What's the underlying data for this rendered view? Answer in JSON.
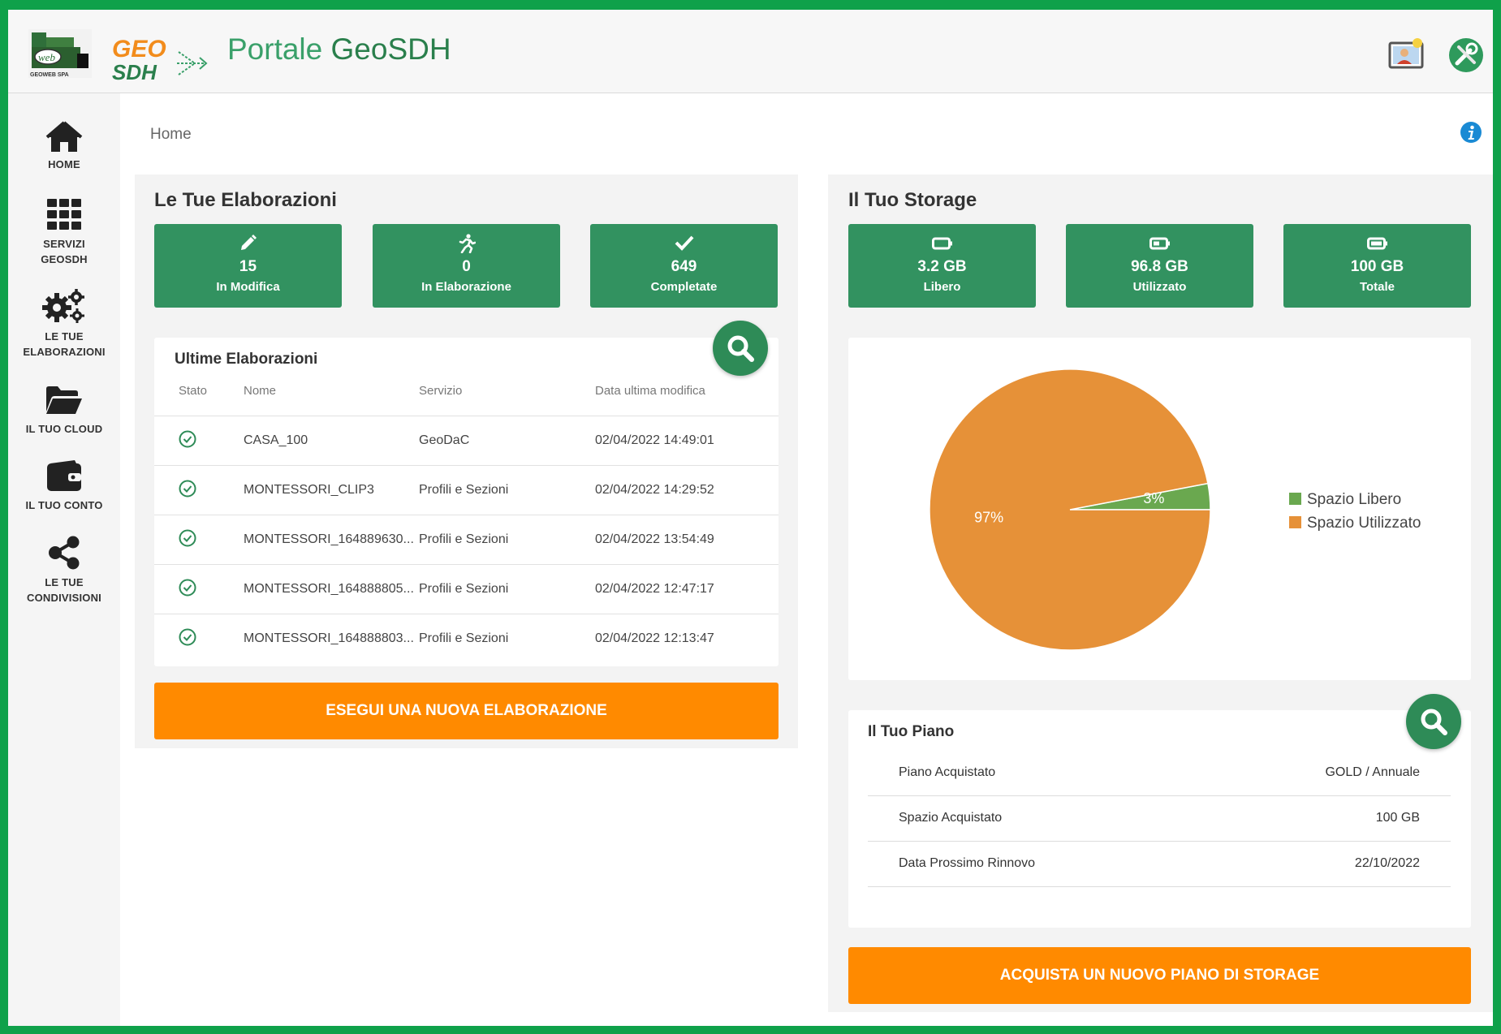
{
  "header": {
    "logo_geoweb_text": "GEOWEB SPA",
    "logo_geosdh_text": "GEO SDH",
    "title_light": "Portale ",
    "title_strong": "GeoSDH"
  },
  "sidebar": {
    "items": [
      {
        "label_line1": "HOME",
        "label_line2": "",
        "icon": "home-icon"
      },
      {
        "label_line1": "SERVIZI",
        "label_line2": "GEOSDH",
        "icon": "grid-icon"
      },
      {
        "label_line1": "LE TUE",
        "label_line2": "ELABORAZIONI",
        "icon": "gears-icon"
      },
      {
        "label_line1": "IL TUO CLOUD",
        "label_line2": "",
        "icon": "folder-open-icon"
      },
      {
        "label_line1": "IL TUO CONTO",
        "label_line2": "",
        "icon": "wallet-icon"
      },
      {
        "label_line1": "LE TUE",
        "label_line2": "CONDIVISIONI",
        "icon": "share-icon"
      }
    ]
  },
  "breadcrumb": "Home",
  "elaborazioni": {
    "title": "Le Tue Elaborazioni",
    "stats": [
      {
        "value": "15",
        "caption": "In Modifica",
        "icon": "pencil-icon"
      },
      {
        "value": "0",
        "caption": "In Elaborazione",
        "icon": "running-icon"
      },
      {
        "value": "649",
        "caption": "Completate",
        "icon": "check-icon"
      }
    ],
    "recent": {
      "title": "Ultime Elaborazioni",
      "columns": [
        "Stato",
        "Nome",
        "Servizio",
        "Data ultima modifica"
      ],
      "rows": [
        {
          "nome": "CASA_100",
          "servizio": "GeoDaC",
          "data": "02/04/2022 14:49:01"
        },
        {
          "nome": "MONTESSORI_CLIP3",
          "servizio": "Profili e Sezioni",
          "data": "02/04/2022 14:29:52"
        },
        {
          "nome": "MONTESSORI_164889630...",
          "servizio": "Profili e Sezioni",
          "data": "02/04/2022 13:54:49"
        },
        {
          "nome": "MONTESSORI_164888805...",
          "servizio": "Profili e Sezioni",
          "data": "02/04/2022 12:47:17"
        },
        {
          "nome": "MONTESSORI_164888803...",
          "servizio": "Profili e Sezioni",
          "data": "02/04/2022 12:13:47"
        }
      ]
    },
    "action_label": "ESEGUI UNA NUOVA ELABORAZIONE"
  },
  "storage": {
    "title": "Il Tuo Storage",
    "stats": [
      {
        "value": "3.2 GB",
        "caption": "Libero",
        "icon": "battery-empty-icon"
      },
      {
        "value": "96.8 GB",
        "caption": "Utilizzato",
        "icon": "battery-half-icon"
      },
      {
        "value": "100 GB",
        "caption": "Totale",
        "icon": "battery-full-icon"
      }
    ],
    "plan": {
      "title": "Il Tuo Piano",
      "rows": [
        {
          "key": "Piano Acquistato",
          "value": "GOLD / Annuale"
        },
        {
          "key": "Spazio Acquistato",
          "value": "100 GB"
        },
        {
          "key": "Data Prossimo Rinnovo",
          "value": "22/10/2022"
        }
      ]
    },
    "action_label": "ACQUISTA UN NUOVO PIANO DI STORAGE"
  },
  "chart_data": {
    "type": "pie",
    "categories": [
      "Spazio Libero",
      "Spazio Utilizzato"
    ],
    "values": [
      3,
      97
    ],
    "labels": [
      "3%",
      "97%"
    ],
    "colors": [
      "#6aa84f",
      "#e69138"
    ],
    "legend": "right"
  },
  "colors": {
    "brand_green": "#329260",
    "frame_green": "#0fa14a",
    "orange": "#ff8a00",
    "info_blue": "#1a8ad4"
  }
}
